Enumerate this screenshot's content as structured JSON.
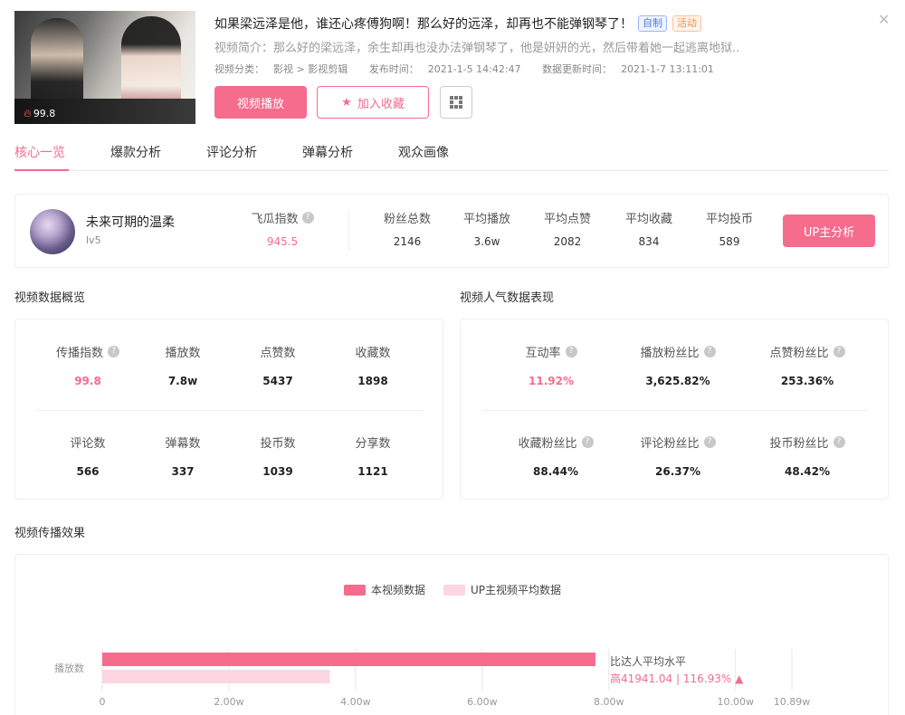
{
  "video": {
    "title": "如果梁远泽是他，谁还心疼傅狗啊！那么好的远泽，却再也不能弹钢琴了！",
    "tags": [
      "自制",
      "活动"
    ],
    "description": "视频简介：那么好的梁远泽，余生却再也没办法弹钢琴了，他是妍妍的光，然后带着她一起逃离地狱..",
    "category_label": "视频分类：",
    "category_path": "影视 > 影视剪辑",
    "publish_label": "发布时间：",
    "publish_time": "2021-1-5 14:42:47",
    "update_label": "数据更新时间：",
    "update_time": "2021-1-7 13:11:01",
    "heat": "99.8",
    "play_button": "视频播放",
    "fav_button": "加入收藏"
  },
  "tabs": [
    {
      "label": "核心一览",
      "active": true
    },
    {
      "label": "爆款分析"
    },
    {
      "label": "评论分析"
    },
    {
      "label": "弹幕分析"
    },
    {
      "label": "观众画像"
    }
  ],
  "up": {
    "name": "未来可期的温柔",
    "level": "lv5",
    "feigua_label": "飞瓜指数",
    "feigua_value": "945.5",
    "stats": [
      {
        "label": "粉丝总数",
        "value": "2146"
      },
      {
        "label": "平均播放",
        "value": "3.6w"
      },
      {
        "label": "平均点赞",
        "value": "2082"
      },
      {
        "label": "平均收藏",
        "value": "834"
      },
      {
        "label": "平均投币",
        "value": "589"
      }
    ],
    "analysis_button": "UP主分析"
  },
  "overview": {
    "title": "视频数据概览",
    "row1": [
      {
        "label": "传播指数",
        "value": "99.8"
      },
      {
        "label": "播放数",
        "value": "7.8w"
      },
      {
        "label": "点赞数",
        "value": "5437"
      },
      {
        "label": "收藏数",
        "value": "1898"
      }
    ],
    "row2": [
      {
        "label": "评论数",
        "value": "566"
      },
      {
        "label": "弹幕数",
        "value": "337"
      },
      {
        "label": "投币数",
        "value": "1039"
      },
      {
        "label": "分享数",
        "value": "1121"
      }
    ]
  },
  "popularity": {
    "title": "视频人气数据表现",
    "row1": [
      {
        "label": "互动率",
        "value": "11.92%"
      },
      {
        "label": "播放粉丝比",
        "value": "3,625.82%"
      },
      {
        "label": "点赞粉丝比",
        "value": "253.36%"
      }
    ],
    "row2": [
      {
        "label": "收藏粉丝比",
        "value": "88.44%"
      },
      {
        "label": "评论粉丝比",
        "value": "26.37%"
      },
      {
        "label": "投币粉丝比",
        "value": "48.42%"
      }
    ]
  },
  "effect": {
    "title": "视频传播效果"
  },
  "chart_data": {
    "type": "bar",
    "orientation": "horizontal",
    "categories": [
      "播放数"
    ],
    "series": [
      {
        "name": "本视频数据",
        "values": [
          77880
        ],
        "color": "#f56c8d"
      },
      {
        "name": "UP主视频平均数据",
        "values": [
          35939
        ],
        "color": "#fcd6e0"
      }
    ],
    "xlim": [
      0,
      108900
    ],
    "x_ticks": [
      "0",
      "2.00w",
      "4.00w",
      "6.00w",
      "8.00w",
      "10.00w",
      "10.89w"
    ],
    "x_tick_values": [
      0,
      20000,
      40000,
      60000,
      80000,
      100000,
      108900
    ],
    "annotation_title": "比达人平均水平",
    "annotation_value": "高41941.04 | 116.93%",
    "annotation_arrow": "▲"
  },
  "colors": {
    "accent": "#f56c8d",
    "accent_light": "#fcd6e0",
    "tag_blue": "#4a7cf0",
    "tag_orange": "#ff8a3d"
  }
}
